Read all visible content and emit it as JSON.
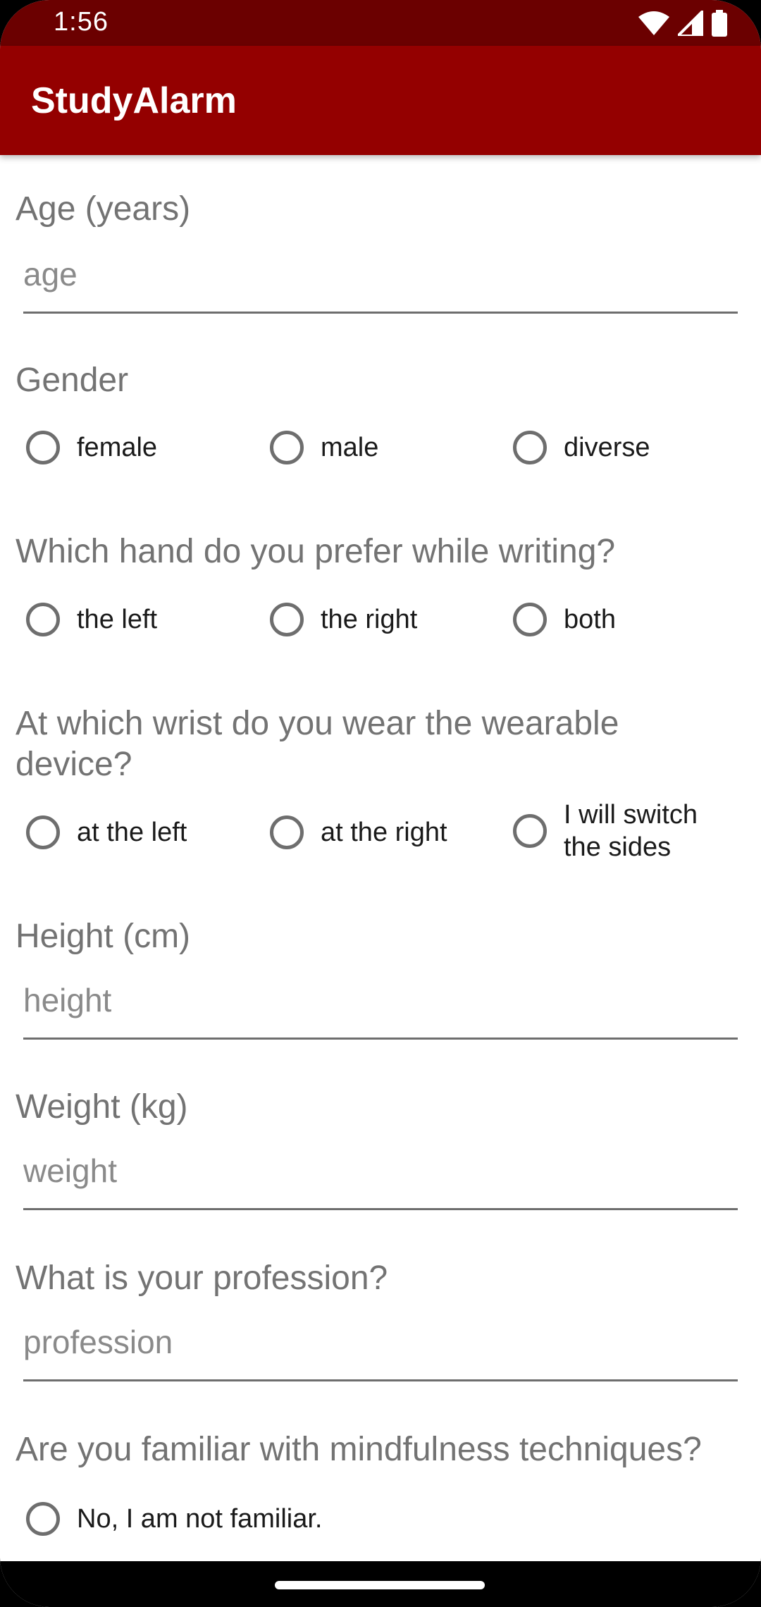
{
  "status_bar": {
    "time": "1:56",
    "icons": [
      "wifi-icon",
      "signal-icon",
      "battery-icon"
    ]
  },
  "app_bar": {
    "title": "StudyAlarm",
    "color": "#940000",
    "status_color": "#6b0000"
  },
  "form": {
    "age": {
      "label": "Age (years)",
      "placeholder": "age"
    },
    "gender": {
      "label": "Gender",
      "options": [
        "female",
        "male",
        "diverse"
      ]
    },
    "hand": {
      "label": "Which hand do you prefer while writing?",
      "options": [
        "the left",
        "the right",
        "both"
      ]
    },
    "wrist": {
      "label": "At which wrist do you wear the wearable device?",
      "options": [
        "at the left",
        "at the right",
        "I will switch the sides"
      ]
    },
    "height": {
      "label": "Height (cm)",
      "placeholder": "height"
    },
    "weight": {
      "label": "Weight (kg)",
      "placeholder": "weight"
    },
    "profession": {
      "label": "What is your profession?",
      "placeholder": "profession"
    },
    "mindfulness": {
      "label": "Are you familiar with mindfulness techniques?",
      "options": [
        "No, I am not familiar."
      ]
    }
  }
}
